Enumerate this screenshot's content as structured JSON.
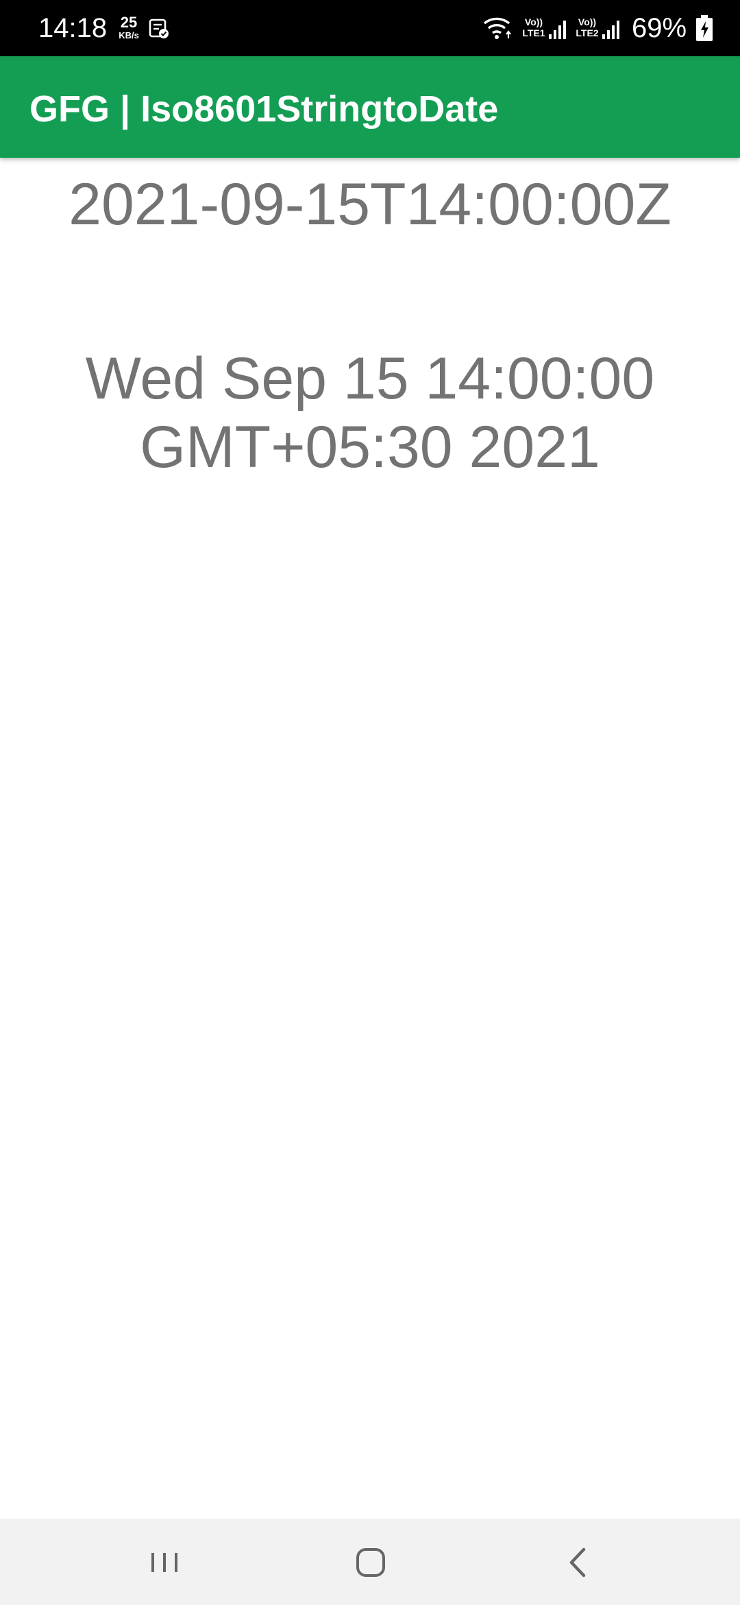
{
  "status_bar": {
    "time": "14:18",
    "net_speed_value": "25",
    "net_speed_unit": "KB/s",
    "lte1_label_top": "Vo))",
    "lte1_label_bottom": "LTE1",
    "lte2_label_top": "Vo))",
    "lte2_label_bottom": "LTE2",
    "battery_percent": "69%"
  },
  "app_bar": {
    "title": "GFG | Iso8601StringtoDate",
    "color": "#139e54"
  },
  "content": {
    "iso_string": "2021-09-15T14:00:00Z",
    "parsed_date": "Wed Sep 15 14:00:00 GMT+05:30 2021"
  },
  "nav_bar": {
    "icons": [
      "recents-icon",
      "home-icon",
      "back-icon"
    ]
  }
}
